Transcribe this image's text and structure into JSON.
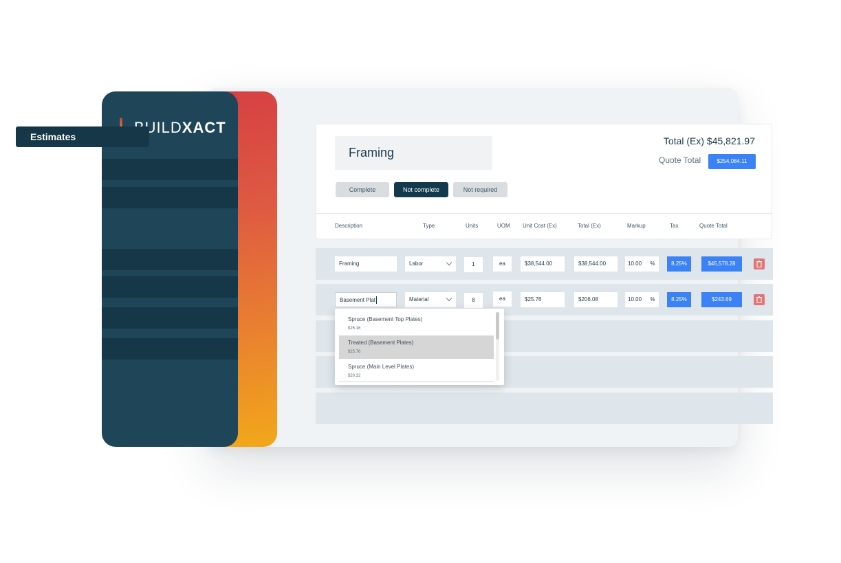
{
  "brand": {
    "name_part1": "BUILD",
    "name_part2": "XACT"
  },
  "sidebar": {
    "active_item": "Estimates"
  },
  "header": {
    "title": "Framing",
    "total_ex": "Total (Ex) $45,821.97",
    "quote_total_label": "Quote Total",
    "quote_total_value": "$254,084.11",
    "status_buttons": {
      "complete": "Complete",
      "not_complete": "Not complete",
      "not_required": "Not required"
    }
  },
  "columns": [
    "Description",
    "Type",
    "Units",
    "UOM",
    "Unit Cost (Ex)",
    "Total (Ex)",
    "Markup",
    "Tax",
    "Quote Total"
  ],
  "rows": [
    {
      "description": "Framing",
      "type": "Labor",
      "units": "1",
      "uom": "ea",
      "unit_cost": "$38,544.00",
      "total": "$38,544.00",
      "markup": "10.00",
      "markup_unit": "%",
      "tax": "8.25%",
      "quote_total": "$45,578.28"
    },
    {
      "description": "Basement Plat",
      "type": "Material",
      "units": "8",
      "uom": "ea",
      "unit_cost": "$25.76",
      "total": "$206.08",
      "markup": "10.00",
      "markup_unit": "%",
      "tax": "8.25%",
      "quote_total": "$243.69"
    }
  ],
  "dropdown": {
    "items": [
      {
        "name": "Spruce (Basement Top Plates)",
        "price": "$25.16"
      },
      {
        "name": "Treated (Basement Plates)",
        "price": "$25.76"
      },
      {
        "name": "Spruce (Main Level Plates)",
        "price": "$20.32"
      }
    ]
  },
  "colors": {
    "sidebar": "#1e4658",
    "accent_blue": "#3b82f6",
    "dark_button": "#13394c",
    "delete": "#e57373"
  }
}
